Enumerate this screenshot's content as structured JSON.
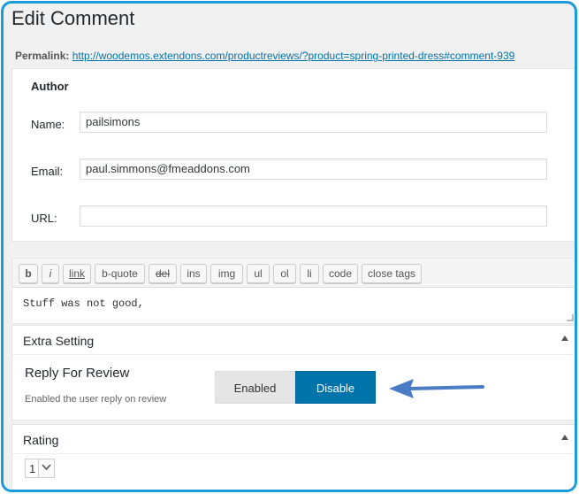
{
  "page": {
    "title": "Edit Comment",
    "permalink_label": "Permalink:",
    "permalink_url": "http://woodemos.extendons.com/productreviews/?product=spring-printed-dress#comment-939"
  },
  "author": {
    "section_title": "Author",
    "name_label": "Name:",
    "name_value": "pailsimons",
    "email_label": "Email:",
    "email_value": "paul.simmons@fmeaddons.com",
    "url_label": "URL:",
    "url_value": ""
  },
  "editor": {
    "buttons": [
      "b",
      "i",
      "link",
      "b-quote",
      "del",
      "ins",
      "img",
      "ul",
      "ol",
      "li",
      "code",
      "close tags"
    ],
    "content": "Stuff was not good,"
  },
  "extra_setting": {
    "title": "Extra Setting",
    "setting_title": "Reply For Review",
    "setting_desc": "Enabled the user reply on review",
    "enabled_label": "Enabled",
    "disable_label": "Disable",
    "selected": "Disable"
  },
  "rating": {
    "title": "Rating",
    "selected_value": "1"
  },
  "colors": {
    "frame_border": "#1b9bd8",
    "accent": "#0073aa",
    "arrow": "#4a7cc6"
  }
}
